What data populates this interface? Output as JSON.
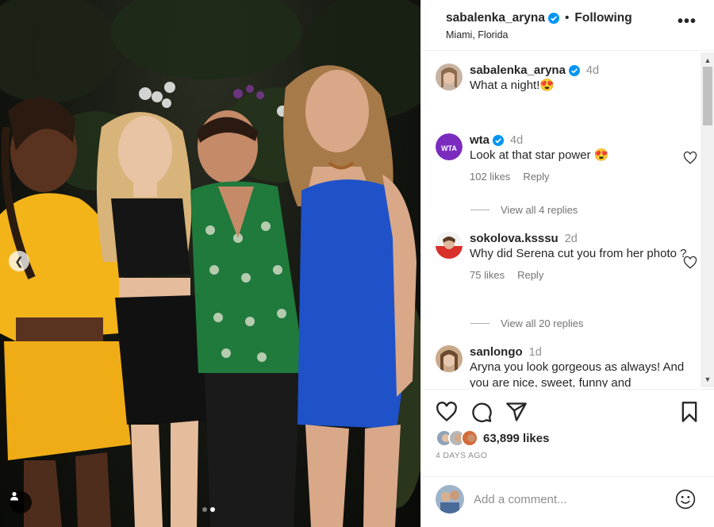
{
  "post": {
    "username": "sabalenka_aryna",
    "separator": "•",
    "follow_status": "Following",
    "location": "Miami, Florida",
    "more_label": "•••",
    "carousel": {
      "total": 2,
      "current": 2
    }
  },
  "caption": {
    "username": "sabalenka_aryna",
    "time": "4d",
    "text": "What a night!😍"
  },
  "comments": [
    {
      "username": "wta",
      "verified": true,
      "time": "4d",
      "text": "Look at that star power 😍",
      "likes": "102 likes",
      "reply": "Reply",
      "view_replies": "View all 4 replies"
    },
    {
      "username": "sokolova.ksssu",
      "verified": false,
      "time": "2d",
      "text": "Why did Serena cut you from her photo ?",
      "likes": "75 likes",
      "reply": "Reply",
      "view_replies": "View all 20 replies"
    },
    {
      "username": "sanlongo",
      "verified": false,
      "time": "1d",
      "text": "Aryna you look gorgeous as always! And you are nice, sweet, funny and"
    }
  ],
  "stats": {
    "likes": "63,899 likes",
    "posted": "4 DAYS AGO"
  },
  "composer": {
    "placeholder": "Add a comment..."
  },
  "colors": {
    "verified": "#0095f6",
    "wta_purple": "#7b2cbf",
    "meta_gray": "#737373"
  },
  "icons": [
    "chevron-left-icon",
    "user-tag-icon",
    "verified-icon",
    "heart-icon",
    "comment-icon",
    "share-icon",
    "bookmark-icon",
    "emoji-icon",
    "more-icon"
  ]
}
